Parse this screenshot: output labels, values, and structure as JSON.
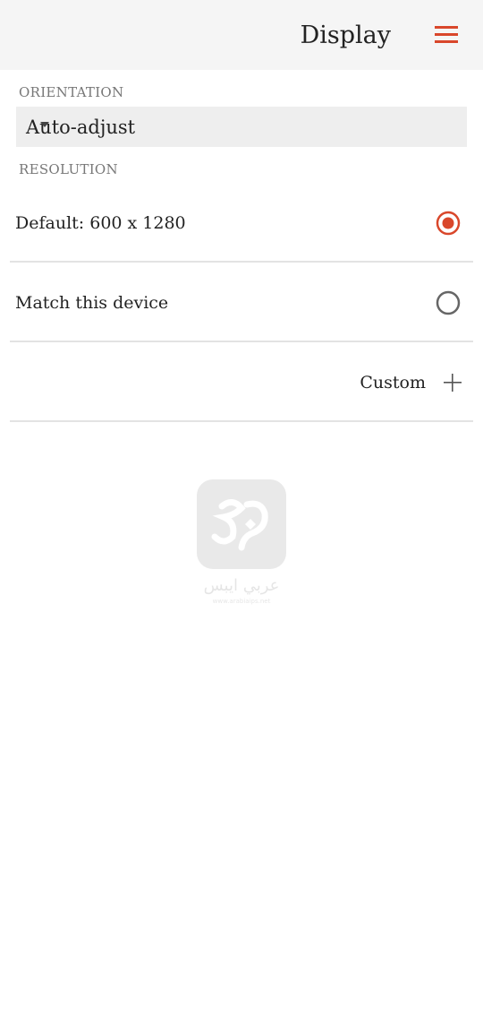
{
  "header": {
    "title": "Display",
    "menu_icon": "hamburger-menu-icon"
  },
  "orientation": {
    "label": "ORIENTATION",
    "selected_value": "Auto-adjust",
    "caret_icon": "dropdown-caret-icon"
  },
  "resolution": {
    "label": "RESOLUTION",
    "options": [
      {
        "label": "Default: 600 x 1280",
        "selected": true
      },
      {
        "label": "Match this device",
        "selected": false
      }
    ],
    "custom_label": "Custom",
    "custom_icon": "plus-icon"
  },
  "watermark": {
    "text": "عربي ايبس",
    "url": "www.arabiaips.net"
  },
  "colors": {
    "accent": "#d9472b",
    "header_bg": "#f5f5f5",
    "select_bg": "#eeeeee",
    "divider": "#e3e3e3",
    "label_gray": "#777777",
    "radio_unselected": "#666666"
  }
}
